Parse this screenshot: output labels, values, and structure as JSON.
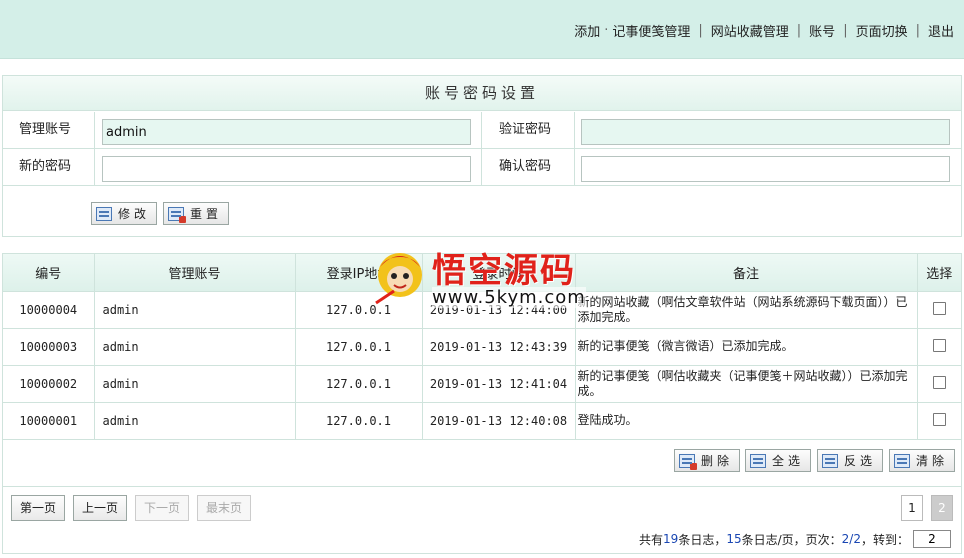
{
  "topnav": {
    "add": "添加",
    "dot": "·",
    "notes": "记事便笺管理",
    "favorites": "网站收藏管理",
    "account": "账号",
    "page_switch": "页面切换",
    "logout": "退出"
  },
  "settings": {
    "title": "账号密码设置",
    "account_label": "管理账号",
    "account_value": "admin",
    "verify_label": "验证密码",
    "verify_value": "",
    "new_pwd_label": "新的密码",
    "new_pwd_value": "",
    "confirm_label": "确认密码",
    "confirm_value": "",
    "modify_btn": "修改",
    "reset_btn": "重置"
  },
  "log": {
    "headers": [
      "编号",
      "管理账号",
      "登录IP地址",
      "登录时间",
      "备注",
      "选择"
    ],
    "rows": [
      {
        "id": "10000004",
        "account": "admin",
        "ip": "127.0.0.1",
        "time": "2019-01-13 12:44:00",
        "note": "新的网站收藏（啊估文章软件站（网站系统源码下载页面））已添加完成。"
      },
      {
        "id": "10000003",
        "account": "admin",
        "ip": "127.0.0.1",
        "time": "2019-01-13 12:43:39",
        "note": "新的记事便笺（微言微语）已添加完成。"
      },
      {
        "id": "10000002",
        "account": "admin",
        "ip": "127.0.0.1",
        "time": "2019-01-13 12:41:04",
        "note": "新的记事便笺（啊估收藏夹（记事便笺＋网站收藏））已添加完成。"
      },
      {
        "id": "10000001",
        "account": "admin",
        "ip": "127.0.0.1",
        "time": "2019-01-13 12:40:08",
        "note": "登陆成功。"
      }
    ],
    "actions": {
      "delete": "删除",
      "select_all": "全选",
      "invert": "反选",
      "clear": "清除"
    }
  },
  "pager": {
    "first": "第一页",
    "prev": "上一页",
    "next": "下一页",
    "last": "最末页",
    "pages": [
      "1",
      "2"
    ],
    "current_page": "2",
    "info_prefix": "共有",
    "total": "19",
    "info_mid1": "条日志，",
    "per_page": "15",
    "info_mid2": "条日志/页，页次：",
    "page_of": "2/2",
    "info_suffix": "，转到：",
    "jump_value": "2"
  },
  "watermark": {
    "title": "悟空源码",
    "url": "www.5kym.com"
  },
  "colors": {
    "header_bg": "#d4efe8",
    "border": "#cfe3dc",
    "input_tint": "#e6f7f1",
    "link_blue": "#1a47b3",
    "watermark_red": "#e0221a"
  }
}
